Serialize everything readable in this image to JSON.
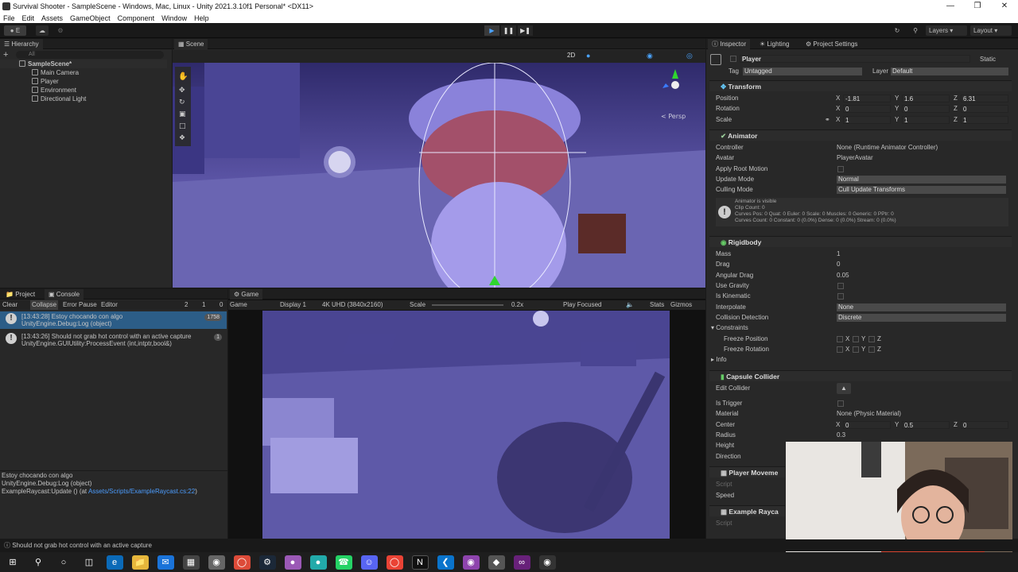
{
  "window": {
    "title": "Survival Shooter - SampleScene - Windows, Mac, Linux - Unity 2021.3.10f1 Personal* <DX11>"
  },
  "menu": [
    "File",
    "Edit",
    "Assets",
    "GameObject",
    "Component",
    "Window",
    "Help"
  ],
  "toolbar": {
    "account_label": "E",
    "layers_label": "Layers",
    "layout_label": "Layout"
  },
  "hierarchy": {
    "tab": "Hierarchy",
    "search_placeholder": "All",
    "scene": "SampleScene*",
    "items": [
      "Main Camera",
      "Player",
      "Environment",
      "Directional Light"
    ]
  },
  "scene_view": {
    "tab": "Scene",
    "mode_2d": "2D",
    "persp_label": "< Persp"
  },
  "game_view": {
    "tab": "Game",
    "view_type": "Game",
    "display": "Display 1",
    "resolution": "4K UHD (3840x2160)",
    "scale_label": "Scale",
    "scale_value": "0.2x",
    "play_focused": "Play Focused",
    "stats": "Stats",
    "gizmos": "Gizmos"
  },
  "console": {
    "project_tab": "Project",
    "console_tab": "Console",
    "clear": "Clear",
    "collapse": "Collapse",
    "error_pause": "Error Pause",
    "editor": "Editor",
    "warn_count": "2",
    "info_count": "1",
    "error_count": "0",
    "entries": [
      {
        "line1": "[13:43:28] Estoy chocando con algo",
        "line2": "UnityEngine.Debug:Log (object)",
        "count": "1758"
      },
      {
        "line1": "[13:43:26] Should not grab hot control with an active capture",
        "line2": "UnityEngine.GUIUtility:ProcessEvent (int,intptr,bool&)",
        "count": "1"
      }
    ],
    "detail_line1": "Estoy chocando con algo",
    "detail_line2": "UnityEngine.Debug:Log (object)",
    "detail_line3": "ExampleRaycast:Update () (at ",
    "detail_link": "Assets/Scripts/ExampleRaycast.cs:22",
    "detail_end": ")"
  },
  "status_bar": "Should not grab hot control with an active capture",
  "inspector": {
    "tabs": [
      "Inspector",
      "Lighting",
      "Project Settings"
    ],
    "object_name": "Player",
    "static_label": "Static",
    "tag_label": "Tag",
    "tag_value": "Untagged",
    "layer_label": "Layer",
    "layer_value": "Default",
    "transform": {
      "title": "Transform",
      "position_label": "Position",
      "rotation_label": "Rotation",
      "scale_label": "Scale",
      "position": {
        "x": "-1.81",
        "y": "1.6",
        "z": "6.31"
      },
      "rotation": {
        "x": "0",
        "y": "0",
        "z": "0"
      },
      "scale": {
        "x": "1",
        "y": "1",
        "z": "1"
      }
    },
    "animator": {
      "title": "Animator",
      "controller_label": "Controller",
      "controller_value": "None (Runtime Animator Controller)",
      "avatar_label": "Avatar",
      "avatar_value": "PlayerAvatar",
      "apply_root_label": "Apply Root Motion",
      "update_mode_label": "Update Mode",
      "update_mode_value": "Normal",
      "culling_label": "Culling Mode",
      "culling_value": "Cull Update Transforms",
      "info1": "Animator is visible",
      "info2": "Clip Count: 0",
      "info3": "Curves Pos: 0 Quat: 0 Euler: 0 Scale: 0 Muscles: 0 Generic: 0 PPtr: 0",
      "info4": "Curves Count: 0 Constant: 0 (0.0%) Dense: 0 (0.0%) Stream: 0 (0.0%)"
    },
    "rigidbody": {
      "title": "Rigidbody",
      "mass_label": "Mass",
      "mass": "1",
      "drag_label": "Drag",
      "drag": "0",
      "angular_drag_label": "Angular Drag",
      "angular_drag": "0.05",
      "use_gravity_label": "Use Gravity",
      "is_kinematic_label": "Is Kinematic",
      "interpolate_label": "Interpolate",
      "interpolate": "None",
      "collision_label": "Collision Detection",
      "collision": "Discrete",
      "constraints_label": "Constraints",
      "freeze_pos_label": "Freeze Position",
      "freeze_rot_label": "Freeze Rotation",
      "info_label": "Info"
    },
    "capsule": {
      "title": "Capsule Collider",
      "edit_label": "Edit Collider",
      "trigger_label": "Is Trigger",
      "material_label": "Material",
      "material": "None (Physic Material)",
      "center_label": "Center",
      "center": {
        "x": "0",
        "y": "0.5",
        "z": "0"
      },
      "radius_label": "Radius",
      "radius": "0.3",
      "height_label": "Height",
      "direction_label": "Direction"
    },
    "player_movement": {
      "title": "Player Moveme",
      "script_label": "Script",
      "speed_label": "Speed"
    },
    "example_raycast": {
      "title": "Example Rayca",
      "script_label": "Script"
    }
  },
  "axis_letters": {
    "x": "X",
    "y": "Y",
    "z": "Z"
  }
}
